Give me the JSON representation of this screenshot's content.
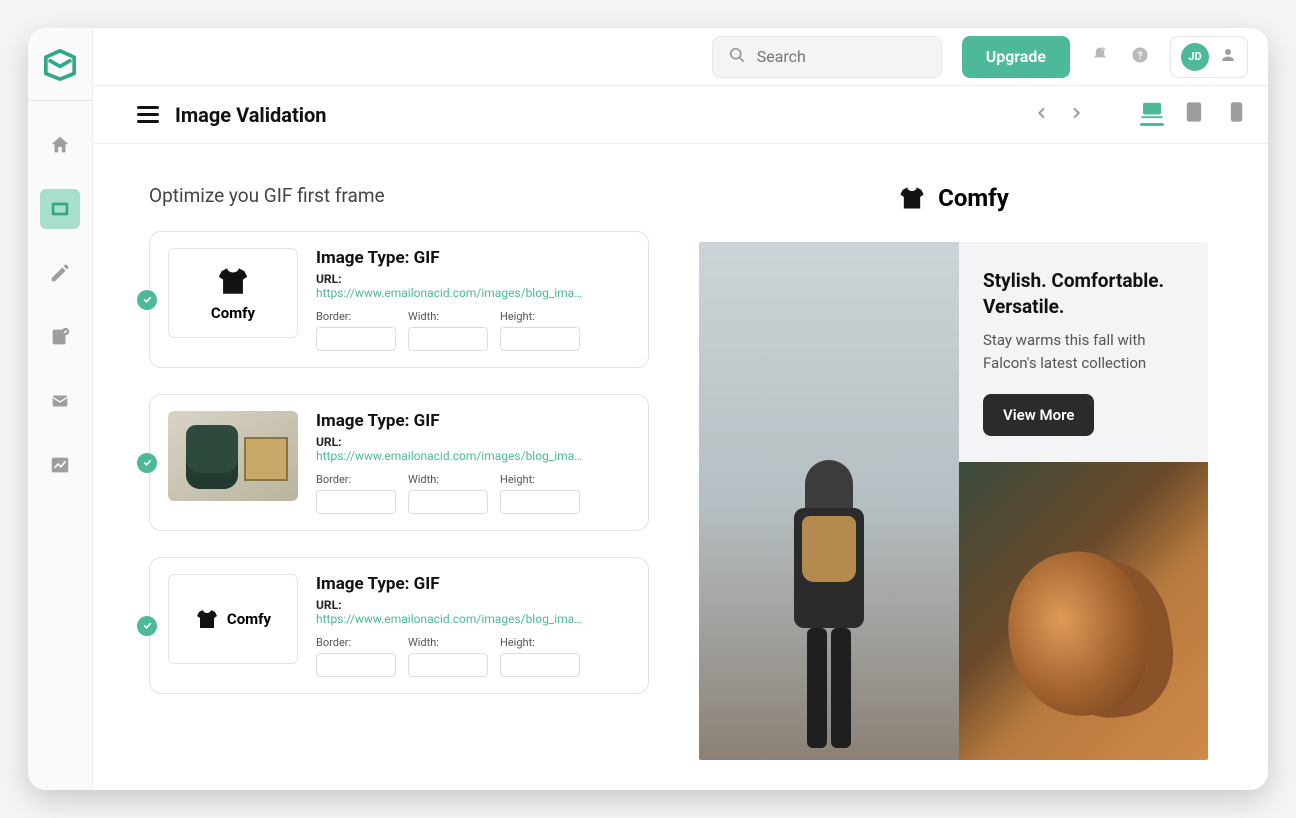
{
  "topbar": {
    "search_placeholder": "Search",
    "upgrade_label": "Upgrade",
    "avatar_initials": "JD"
  },
  "page": {
    "title": "Image Validation",
    "section_title": "Optimize you GIF first frame"
  },
  "labels": {
    "image_type_prefix": "Image Type: ",
    "url": "URL:",
    "border": "Border:",
    "width": "Width:",
    "height": "Height:"
  },
  "cards": [
    {
      "brand": "Comfy",
      "type": "GIF",
      "url": "https://www.emailonacid.com/images/blog_image...",
      "thumb": "logo"
    },
    {
      "brand": "",
      "type": "GIF",
      "url": "https://www.emailonacid.com/images/blog_image...",
      "thumb": "photo"
    },
    {
      "brand": "Comfy",
      "type": "GIF",
      "url": "https://www.emailonacid.com/images/blog_image...",
      "thumb": "inline-logo"
    }
  ],
  "preview": {
    "brand": "Comfy",
    "headline": "Stylish. Comfortable. Versatile.",
    "subtext": "Stay warms this fall with Falcon's latest collection",
    "cta": "View More"
  }
}
